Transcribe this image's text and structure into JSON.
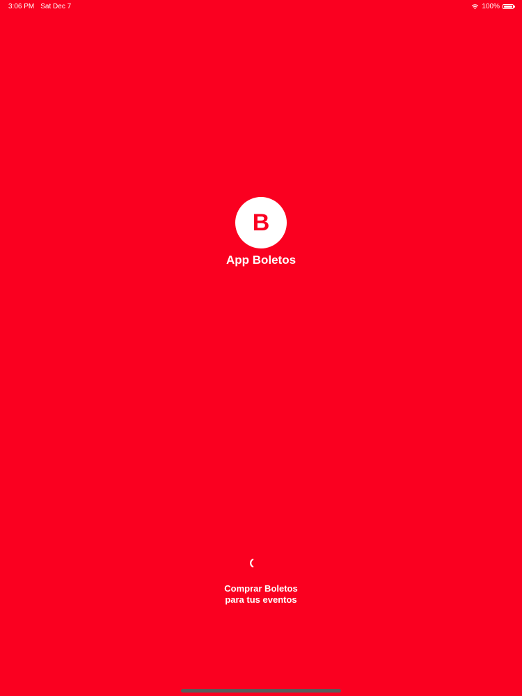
{
  "status_bar": {
    "time": "3:06 PM",
    "date": "Sat Dec 7",
    "battery_percent": "100%",
    "battery_level": 1.0,
    "wifi_icon": "wifi-icon",
    "battery_icon": "battery-icon"
  },
  "logo": {
    "letter": "B"
  },
  "app_name": "App Boletos",
  "tagline": {
    "line1": "Comprar Boletos",
    "line2": "para tus eventos"
  },
  "colors": {
    "background": "#FA0020",
    "foreground": "#FFFFFF",
    "home_indicator": "#5A5A5A"
  }
}
